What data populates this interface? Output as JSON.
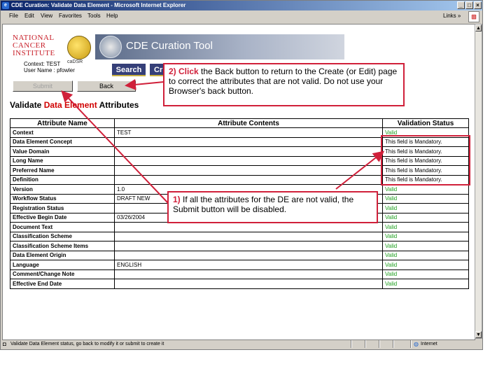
{
  "window": {
    "title": "CDE Curation: Validate Data Element - Microsoft Internet Explorer",
    "controls": {
      "minimize": "_",
      "maximize": "□",
      "close": "×"
    }
  },
  "menu": {
    "items": [
      "File",
      "Edit",
      "View",
      "Favorites",
      "Tools",
      "Help"
    ],
    "links": "Links",
    "chevron": "»"
  },
  "header": {
    "nci_line1": "NATIONAL",
    "nci_line2": "CANCER",
    "nci_line3": "INSTITUTE",
    "cadsr_label": "caDSR",
    "banner_title": "CDE Curation Tool",
    "context": "Context: TEST",
    "user": "User Name : pfowler",
    "nav": {
      "search": "Search",
      "create": "Cr"
    }
  },
  "form": {
    "submit_label": "Submit",
    "back_label": "Back",
    "title_pre": "Validate ",
    "title_red": "Data Element",
    "title_post": " Attributes"
  },
  "table": {
    "headers": [
      "Attribute Name",
      "Attribute Contents",
      "Validation Status"
    ],
    "rows": [
      {
        "name": "Context",
        "contents": "TEST",
        "status": "Valid",
        "valid": true
      },
      {
        "name": "Data Element Concept",
        "contents": "",
        "status": "This field is Mandatory.",
        "valid": false
      },
      {
        "name": "Value Domain",
        "contents": "",
        "status": "This field is Mandatory.",
        "valid": false
      },
      {
        "name": "Long Name",
        "contents": "",
        "status": "This field is Mandatory.",
        "valid": false
      },
      {
        "name": "Preferred Name",
        "contents": "",
        "status": "This field is Mandatory.",
        "valid": false
      },
      {
        "name": "Definition",
        "contents": "",
        "status": "This field is Mandatory.",
        "valid": false
      },
      {
        "name": "Version",
        "contents": "1.0",
        "status": "Valid",
        "valid": true
      },
      {
        "name": "Workflow Status",
        "contents": "DRAFT NEW",
        "status": "Valid",
        "valid": true
      },
      {
        "name": "Registration Status",
        "contents": "",
        "status": "Valid",
        "valid": true
      },
      {
        "name": "Effective Begin Date",
        "contents": "03/26/2004",
        "status": "Valid",
        "valid": true
      },
      {
        "name": "Document Text",
        "contents": "",
        "status": "Valid",
        "valid": true
      },
      {
        "name": "Classification Scheme",
        "contents": "",
        "status": "Valid",
        "valid": true
      },
      {
        "name": "Classification Scheme Items",
        "contents": "",
        "status": "Valid",
        "valid": true
      },
      {
        "name": "Data Element Origin",
        "contents": "",
        "status": "Valid",
        "valid": true
      },
      {
        "name": "Language",
        "contents": "ENGLISH",
        "status": "Valid",
        "valid": true
      },
      {
        "name": "Comment/Change Note",
        "contents": "",
        "status": "Valid",
        "valid": true
      },
      {
        "name": "Effective End Date",
        "contents": "",
        "status": "Valid",
        "valid": true
      }
    ]
  },
  "callouts": {
    "back": {
      "step": "2)",
      "action": "Click",
      "text": " the Back button to return to the Create (or Edit) page to correct the attributes that are not valid. Do not use your Browser's back button."
    },
    "submit": {
      "step": "1)",
      "text": " If all the attributes for the DE are not valid, the Submit button will be disabled."
    }
  },
  "statusbar": {
    "message": "Validate Data Element status, go back to modify it or submit to create it",
    "zone": "Internet"
  },
  "colors": {
    "callout_red": "#d0203a",
    "valid_green": "#20a020",
    "nav_blue": "#353f78"
  }
}
